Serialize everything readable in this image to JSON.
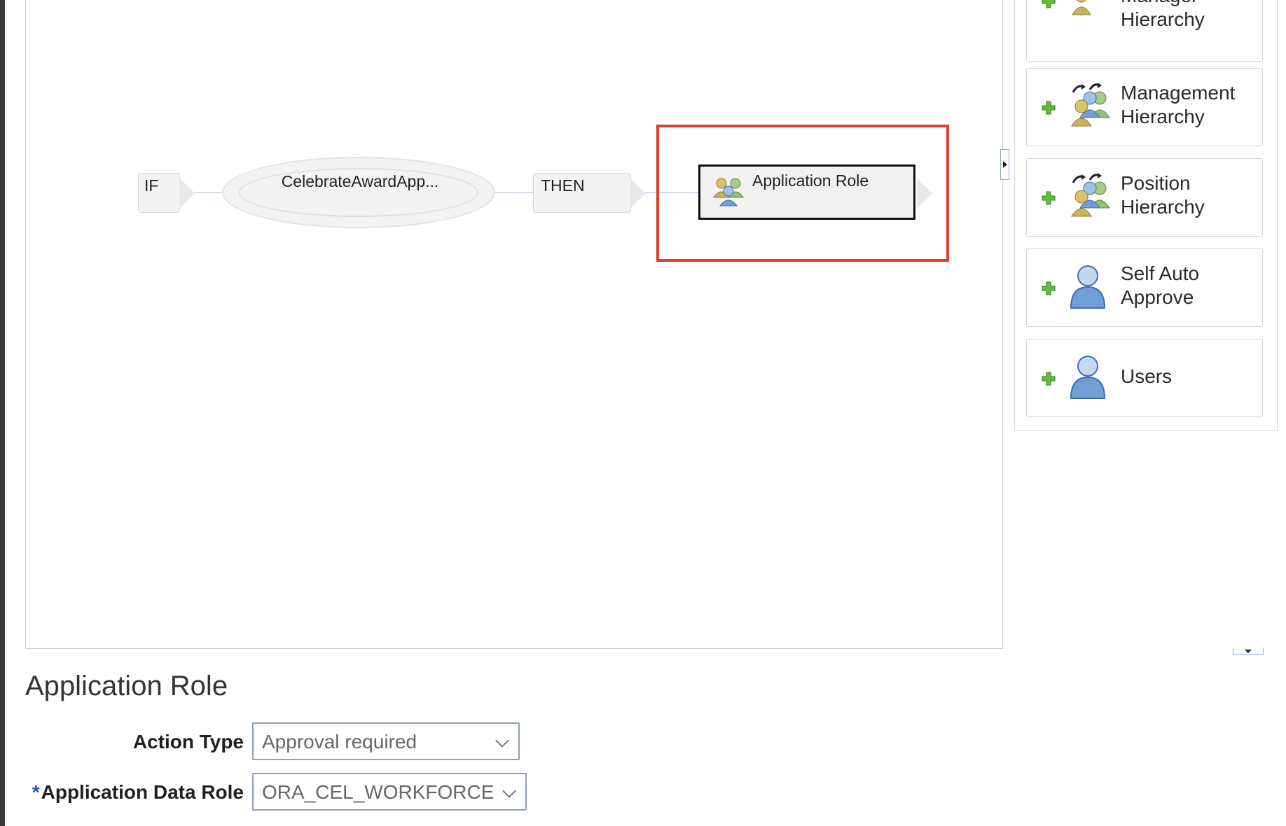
{
  "canvas": {
    "if_label": "IF",
    "condition_label": "CelebrateAwardApp...",
    "then_label": "THEN",
    "approver_label": "Application Role"
  },
  "palette": {
    "items": [
      {
        "label_line1": "Manager",
        "label_line2": "Hierarchy",
        "icon": "group-hierarchy-icon"
      },
      {
        "label_line1": "Management",
        "label_line2": "Hierarchy",
        "icon": "group-hierarchy-icon"
      },
      {
        "label_line1": "Position",
        "label_line2": "Hierarchy",
        "icon": "group-hierarchy-icon"
      },
      {
        "label_line1": "Self Auto",
        "label_line2": "Approve",
        "icon": "user-icon"
      },
      {
        "label_line1": "Users",
        "label_line2": "",
        "icon": "user-icon"
      }
    ]
  },
  "form": {
    "title": "Application Role",
    "action_type_label": "Action Type",
    "action_type_value": "Approval required",
    "data_role_required_mark": "*",
    "data_role_label": "Application Data Role",
    "data_role_value": "ORA_CEL_WORKFORCE"
  },
  "colors": {
    "highlight": "#e0402c",
    "required_mark": "#1f5fa8",
    "plus_icon": "#3c9a2e"
  }
}
